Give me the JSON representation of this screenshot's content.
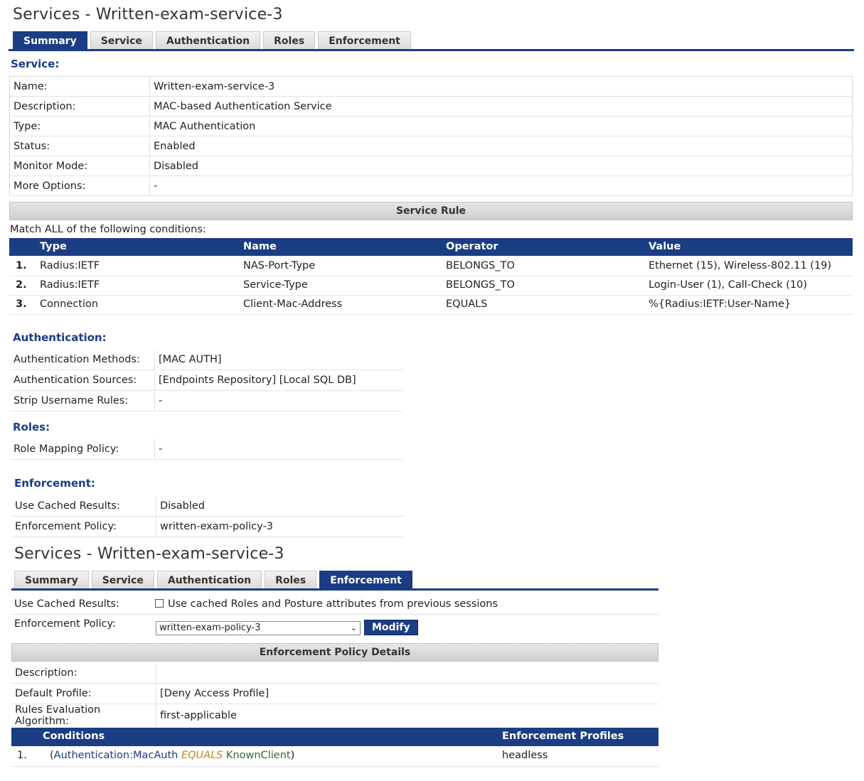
{
  "summary_view": {
    "title": "Services - Written-exam-service-3",
    "tabs": [
      {
        "label": "Summary",
        "active": true
      },
      {
        "label": "Service",
        "active": false
      },
      {
        "label": "Authentication",
        "active": false
      },
      {
        "label": "Roles",
        "active": false
      },
      {
        "label": "Enforcement",
        "active": false
      }
    ],
    "service_heading": "Service:",
    "service_fields": [
      {
        "key": "Name:",
        "value": "Written-exam-service-3"
      },
      {
        "key": "Description:",
        "value": "MAC-based Authentication Service"
      },
      {
        "key": "Type:",
        "value": "MAC Authentication"
      },
      {
        "key": "Status:",
        "value": "Enabled"
      },
      {
        "key": "Monitor Mode:",
        "value": "Disabled"
      },
      {
        "key": "More Options:",
        "value": "-"
      }
    ],
    "service_rule": {
      "bar_label": "Service Rule",
      "match_text": "Match ALL of the following conditions:",
      "columns": [
        "Type",
        "Name",
        "Operator",
        "Value"
      ],
      "rows": [
        {
          "num": "1.",
          "type": "Radius:IETF",
          "name": "NAS-Port-Type",
          "operator": "BELONGS_TO",
          "value": "Ethernet (15), Wireless-802.11 (19)"
        },
        {
          "num": "2.",
          "type": "Radius:IETF",
          "name": "Service-Type",
          "operator": "BELONGS_TO",
          "value": "Login-User (1), Call-Check (10)"
        },
        {
          "num": "3.",
          "type": "Connection",
          "name": "Client-Mac-Address",
          "operator": "EQUALS",
          "value": "%{Radius:IETF:User-Name}"
        }
      ]
    },
    "authentication_heading": "Authentication:",
    "authentication_fields": [
      {
        "key": "Authentication Methods:",
        "value": "[MAC AUTH]"
      },
      {
        "key": "Authentication Sources:",
        "value": "[Endpoints Repository] [Local SQL DB]"
      },
      {
        "key": "Strip Username Rules:",
        "value": "-"
      }
    ],
    "roles_heading": "Roles:",
    "roles_fields": [
      {
        "key": "Role Mapping Policy:",
        "value": "-"
      }
    ],
    "enforcement_heading": "Enforcement:",
    "enforcement_fields": [
      {
        "key": "Use Cached Results:",
        "value": "Disabled"
      },
      {
        "key": "Enforcement Policy:",
        "value": "written-exam-policy-3"
      }
    ]
  },
  "enforcement_view": {
    "title": "Services - Written-exam-service-3",
    "tabs": [
      {
        "label": "Summary",
        "active": false
      },
      {
        "label": "Service",
        "active": false
      },
      {
        "label": "Authentication",
        "active": false
      },
      {
        "label": "Roles",
        "active": false
      },
      {
        "label": "Enforcement",
        "active": true
      }
    ],
    "use_cached_label": "Use Cached Results:",
    "use_cached_checkbox_text": "Use cached Roles and Posture attributes from previous sessions",
    "use_cached_checked": false,
    "policy_label": "Enforcement Policy:",
    "policy_selected": "written-exam-policy-3",
    "modify_button": "Modify",
    "details_bar": "Enforcement Policy Details",
    "details_fields": [
      {
        "key": "Description:",
        "value": ""
      },
      {
        "key": "Default Profile:",
        "value": "[Deny Access Profile]"
      },
      {
        "key": "Rules Evaluation Algorithm:",
        "value": "first-applicable"
      }
    ],
    "rules_columns": [
      "Conditions",
      "Enforcement Profiles"
    ],
    "rules_rows": [
      {
        "num": "1.",
        "open": "(",
        "attribute": "Authentication:MacAuth",
        "operator": "EQUALS",
        "value": "KnownClient",
        "close": ")",
        "profile": "headless"
      }
    ]
  },
  "colors": {
    "accent": "#1a3d84",
    "operator": "#b7892b",
    "value": "#2b6a2b"
  }
}
